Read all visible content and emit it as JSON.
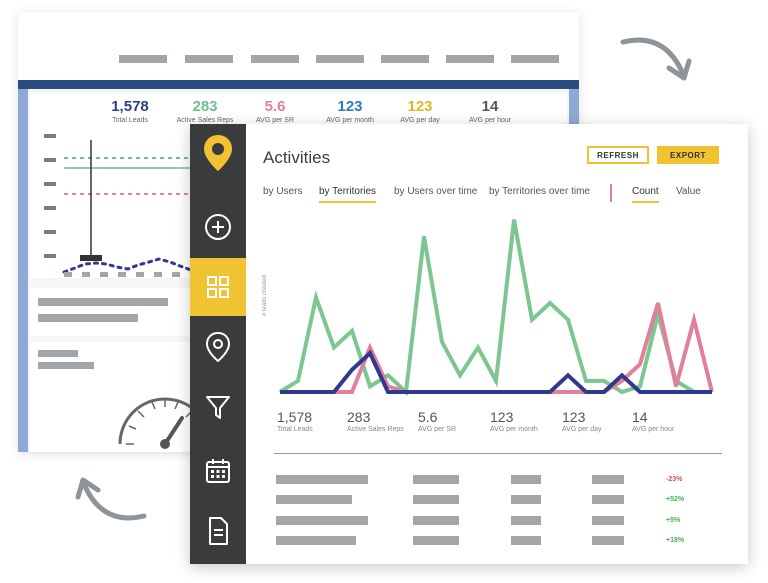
{
  "colors": {
    "yellow": "#f1c232",
    "green": "#7cc68f",
    "pink": "#e0809a",
    "navy": "#2f3a8f",
    "sidebar": "#3a3b3d",
    "blue": "#2b4c83"
  },
  "back_card": {
    "stats": [
      {
        "value": "1,578",
        "label": "Total Leads",
        "color": "#2b3f8c"
      },
      {
        "value": "283",
        "label": "Active Sales Reps",
        "color": "#6cc08b"
      },
      {
        "value": "5.6",
        "label": "AVG per SR",
        "color": "#e0809a"
      },
      {
        "value": "123",
        "label": "AVG per month",
        "color": "#2b7bc0"
      },
      {
        "value": "123",
        "label": "AVG per day",
        "color": "#e3b52a"
      },
      {
        "value": "14",
        "label": "AVG per hour",
        "color": "#555555"
      }
    ]
  },
  "sidebar": {
    "items": [
      {
        "name": "logo-pin-icon"
      },
      {
        "name": "add-circle-icon"
      },
      {
        "name": "dashboard-grid-icon",
        "active": true
      },
      {
        "name": "location-pin-icon"
      },
      {
        "name": "filter-icon"
      },
      {
        "name": "calendar-icon"
      },
      {
        "name": "document-icon"
      }
    ]
  },
  "header": {
    "title": "Activities",
    "refresh_label": "REFRESH",
    "export_label": "EXPORT"
  },
  "tabs": [
    {
      "label": "by Users",
      "active": false
    },
    {
      "label": "by Territories",
      "active": true
    },
    {
      "label": "by Users over time",
      "active": false
    },
    {
      "label": "by Territories over time",
      "active": false
    }
  ],
  "metric_toggle": [
    {
      "label": "Count",
      "active": true
    },
    {
      "label": "Value",
      "active": false
    }
  ],
  "chart_data": {
    "type": "line",
    "ylabel": "# leads created",
    "x": [
      0,
      1,
      2,
      3,
      4,
      5,
      6,
      7,
      8,
      9,
      10,
      11,
      12,
      13,
      14,
      15,
      16,
      17,
      18,
      19,
      20,
      21,
      22,
      23,
      24
    ],
    "ylim": [
      0,
      32
    ],
    "series": [
      {
        "color": "#7cc68f",
        "values": [
          0,
          2,
          17,
          8,
          11,
          1,
          3,
          0,
          28,
          9,
          3,
          8,
          2,
          31,
          13,
          16,
          13,
          2,
          2,
          0,
          1,
          14,
          2,
          0,
          0
        ]
      },
      {
        "color": "#e0809a",
        "values": [
          0,
          0,
          0,
          0,
          0,
          8,
          1,
          0,
          0,
          0,
          0,
          0,
          0,
          0,
          0,
          0,
          0,
          0,
          0,
          2,
          5,
          16,
          1,
          13,
          0
        ]
      },
      {
        "color": "#2f3a8f",
        "values": [
          0,
          0,
          0,
          0,
          4,
          7,
          0,
          0,
          0,
          0,
          0,
          0,
          0,
          0,
          0,
          0,
          3,
          0,
          0,
          3,
          0,
          0,
          0,
          0,
          0
        ]
      }
    ]
  },
  "stats": [
    {
      "value": "1,578",
      "label": "Total Leads"
    },
    {
      "value": "283",
      "label": "Active Sales Reps"
    },
    {
      "value": "5.6",
      "label": "AVG per SR"
    },
    {
      "value": "123",
      "label": "AVG per month"
    },
    {
      "value": "123",
      "label": "AVG per day"
    },
    {
      "value": "14",
      "label": "AVG per hour"
    }
  ],
  "table_rows": [
    {
      "change": "-23%",
      "color": "#d9534f"
    },
    {
      "change": "+52%",
      "color": "#4cae4c"
    },
    {
      "change": "+5%",
      "color": "#4cae4c"
    },
    {
      "change": "+18%",
      "color": "#4cae4c"
    }
  ]
}
